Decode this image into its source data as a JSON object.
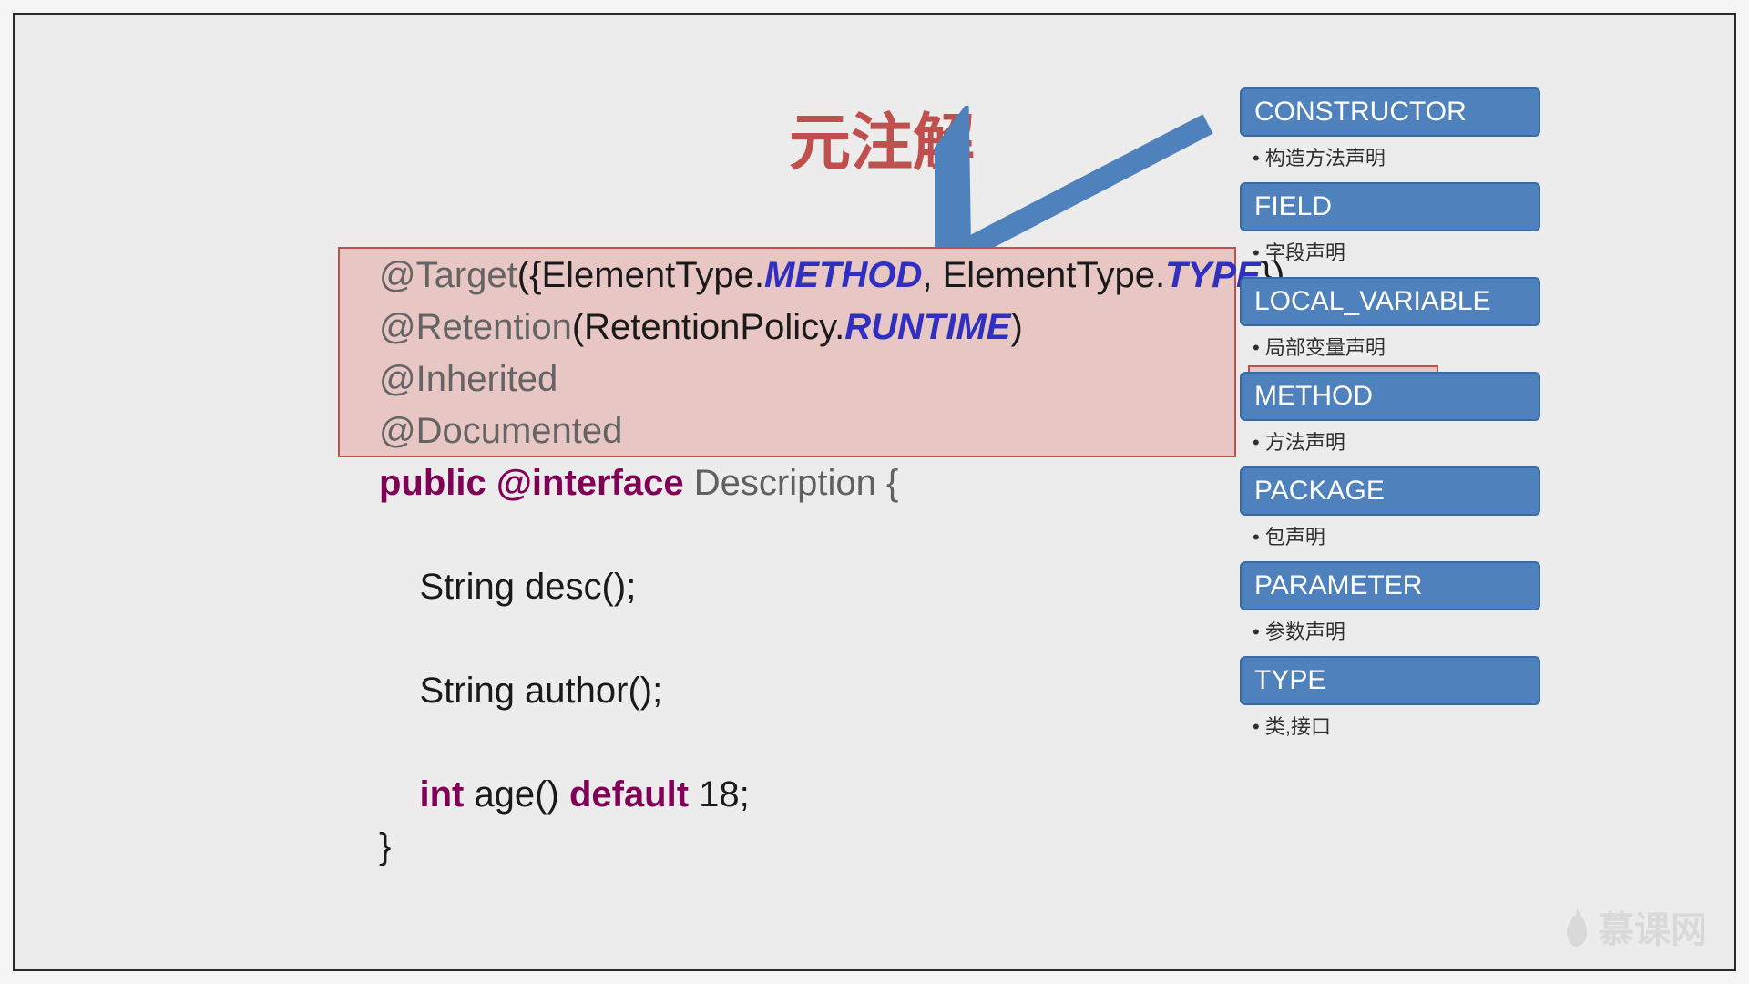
{
  "title": "元注解",
  "code": {
    "l1a": "@Target",
    "l1b": "({ElementType.",
    "l1c": "METHOD",
    "l1d": ", ElementType.",
    "l1e": "TYPE",
    "l1f": "})",
    "l2a": "@Retention",
    "l2b": "(RetentionPolicy.",
    "l2c": "RUNTIME",
    "l2d": ")",
    "l3": "@Inherited",
    "l4": "@Documented",
    "l5a": "public ",
    "l5b": "@interface ",
    "l5c": "Description {",
    "l6": "    String desc();",
    "l7": "    String author();",
    "l8a": "    ",
    "l8b": "int ",
    "l8c": "age() ",
    "l8d": "default ",
    "l8e": "18;",
    "l9": "}"
  },
  "panel": [
    {
      "head": "CONSTRUCTOR",
      "desc": "构造方法声明"
    },
    {
      "head": "FIELD",
      "desc": "字段声明"
    },
    {
      "head": "LOCAL_VARIABLE",
      "desc": "局部变量声明"
    },
    {
      "head": "METHOD",
      "desc": "方法声明"
    },
    {
      "head": "PACKAGE",
      "desc": "包声明"
    },
    {
      "head": "PARAMETER",
      "desc": "参数声明"
    },
    {
      "head": "TYPE",
      "desc": "类,接口"
    }
  ],
  "logo": "慕课网"
}
